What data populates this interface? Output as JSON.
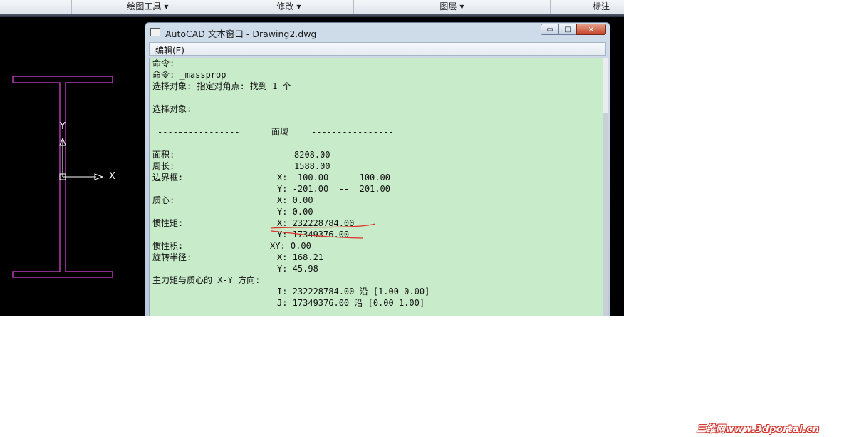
{
  "ribbon": {
    "items": [
      {
        "label": "绘图工具",
        "dropdown": true
      },
      {
        "label": "修改",
        "dropdown": true
      },
      {
        "label": "图层",
        "dropdown": true
      },
      {
        "label": "标注",
        "dropdown": false
      }
    ]
  },
  "drawing": {
    "ucs_x_label": "X",
    "ucs_y_label": "Y",
    "colors": {
      "background": "#000000",
      "ibeam_stroke": "#b43cb4",
      "ucs": "#ffffff"
    }
  },
  "text_window": {
    "title": "AutoCAD 文本窗口 - Drawing2.dwg",
    "controls": {
      "minimize": "▭",
      "maximize": "□",
      "close": "✕"
    },
    "menu": {
      "edit": "编辑(E)"
    },
    "output": {
      "cmd1": "命令:",
      "cmd2": "命令: _massprop",
      "select1": "选择对象: 指定对角点: 找到 1 个",
      "select2": "选择对象:",
      "dashes_left": "----------------",
      "section": "面域",
      "dashes_right": "----------------",
      "area_label": "面积:",
      "area_value": "8208.00",
      "perimeter_label": "周长:",
      "perimeter_value": "1588.00",
      "bbox_label": "边界框:",
      "bbox_x": "X: -100.00  --  100.00",
      "bbox_y": "Y: -201.00  --  201.00",
      "centroid_label": "质心:",
      "centroid_x": "X: 0.00",
      "centroid_y": "Y: 0.00",
      "moi_label": "惯性矩:",
      "moi_x": "X: 232228784.00",
      "moi_y": "Y: 17349376.00",
      "poi_label": "惯性积:",
      "poi_xy": "XY: 0.00",
      "gyr_label": "旋转半径:",
      "gyr_x": "X: 168.21",
      "gyr_y": "Y: 45.98",
      "principal_label": "主力矩与质心的 X-Y 方向:",
      "principal_i": "I: 232228784.00 沿 [1.00 0.00]",
      "principal_j": "J: 17349376.00 沿 [0.00 1.00]"
    },
    "colors": {
      "content_bg": "#c8ecc9",
      "annotation": "#e0302a"
    }
  },
  "watermark": "三维网www.3dportal.cn"
}
